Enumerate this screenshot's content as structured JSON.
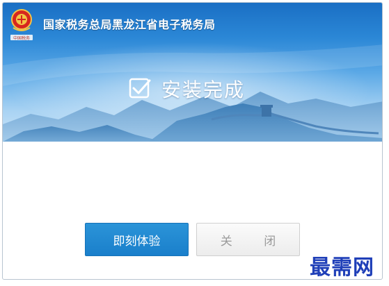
{
  "window": {
    "title": "国家税务总局黑龙江省电子税务局",
    "emblem_caption": "中国税务"
  },
  "status": {
    "icon": "checkbox-check-icon",
    "text": "安装完成"
  },
  "buttons": {
    "experience_label": "即刻体验",
    "close_label": "关 闭"
  },
  "watermark": {
    "text": "最需网"
  },
  "colors": {
    "banner_top": "#1a6fc4",
    "banner_bottom": "#cde6f8",
    "primary_button": "#1a7fcb",
    "watermark": "#1f3fb8"
  }
}
